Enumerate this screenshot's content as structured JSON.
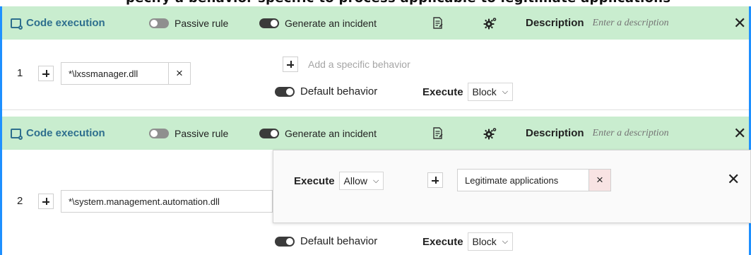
{
  "top_strip_text": "pecify a behavior specific to process applicable to legitimate applications",
  "rules": [
    {
      "header": {
        "title": "Code execution",
        "passive_label": "Passive rule",
        "passive_on": false,
        "incident_label": "Generate an incident",
        "incident_on": true,
        "description_label": "Description",
        "description_placeholder": "Enter a description"
      },
      "number": "1",
      "path": "*\\lxssmanager.dll",
      "add_behavior_hint": "Add a specific behavior",
      "default_behavior_label": "Default behavior",
      "execute_label": "Execute",
      "execute_value": "Block"
    },
    {
      "header": {
        "title": "Code execution",
        "passive_label": "Passive rule",
        "passive_on": false,
        "incident_label": "Generate an incident",
        "incident_on": true,
        "description_label": "Description",
        "description_placeholder": "Enter a description"
      },
      "number": "2",
      "path": "*\\system.management.automation.dll",
      "specific_behavior": {
        "execute_label": "Execute",
        "execute_value": "Allow",
        "process_list": "Legitimate applications"
      },
      "default_behavior_label": "Default behavior",
      "execute_label": "Execute",
      "execute_value": "Block"
    }
  ],
  "icons": {
    "clear": "×",
    "close": "✕",
    "chevron": "⌵"
  },
  "colors": {
    "header_bg": "#c9edcf",
    "title_color": "#2e6f8e",
    "frame_border": "#1e90ff",
    "chip_x_pink": "#f8e3e3"
  }
}
